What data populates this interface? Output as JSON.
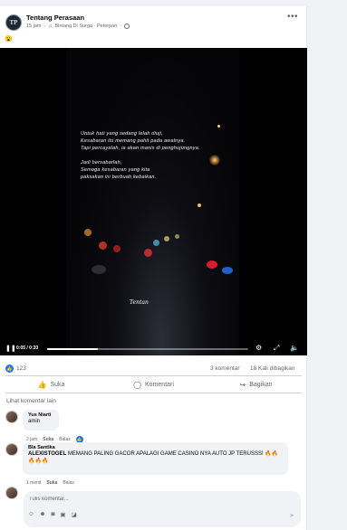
{
  "post": {
    "page_name": "Tentang Perasaan",
    "time": "15 jam",
    "song": "Bintang Di Surga · Peterpan",
    "status_emoji": "😮",
    "avatar_text": "TP"
  },
  "video": {
    "quote_lines": [
      "Untuk hati yang sedang lelah diuji,",
      "Kesabaran itu memang pahit pada awalnya.",
      "Tapi percayalah, ia akan manis di penghujungnya.",
      "Jadi bersabarlah,",
      "Semoga kesabaran yang kita",
      "paksakan ini berbuah kebaikan."
    ],
    "signature": "Tentan",
    "time_display": "0:05 / 0:20",
    "progress": 0.25
  },
  "stats": {
    "likes": "123",
    "comments": "3 komentar",
    "shares": "18 Kali dibagikan"
  },
  "actions": {
    "like": "Suka",
    "comment": "Komentari",
    "share": "Bagikan"
  },
  "see_more_comments": "Lihat komentar lain",
  "comments": [
    {
      "author": "Yus Niarti",
      "text": "amin",
      "time": "2 jam",
      "like": "Suka",
      "reply": "Balas"
    },
    {
      "author": "Bla Santika",
      "text_bold": "ALEXISTOGEL",
      "text": " MEMANG PALING GACOR APALAGI GAME CASINO NYA AUTO JP TERUSSS! 🔥🔥🔥🔥🔥",
      "time": "1 menit",
      "like": "Suka",
      "reply": "Balas"
    }
  ],
  "composer": {
    "placeholder": "Tulis komentar..."
  }
}
